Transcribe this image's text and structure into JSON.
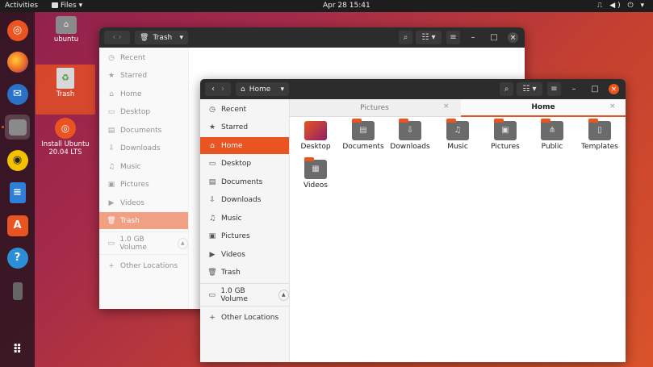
{
  "topbar": {
    "activities": "Activities",
    "app_menu": "Files ▾",
    "clock": "Apr 28  15:41",
    "tray": "⎍ ◀) ⏻ ▾"
  },
  "desktop": {
    "home_label": "ubuntu",
    "trash_label": "Trash",
    "install_label_1": "Install Ubuntu",
    "install_label_2": "20.04 LTS"
  },
  "back_window": {
    "path": "Trash",
    "sidebar": [
      "Recent",
      "Starred",
      "Home",
      "Desktop",
      "Documents",
      "Downloads",
      "Music",
      "Pictures",
      "Videos",
      "Trash"
    ],
    "volume": "1.0 GB Volume",
    "other": "Other Locations"
  },
  "front_window": {
    "path": "Home",
    "sidebar": [
      "Recent",
      "Starred",
      "Home",
      "Desktop",
      "Documents",
      "Downloads",
      "Music",
      "Pictures",
      "Videos",
      "Trash"
    ],
    "volume": "1.0 GB Volume",
    "other": "Other Locations",
    "tabs": [
      "Pictures",
      "Home"
    ],
    "folders": [
      "Desktop",
      "Documents",
      "Downloads",
      "Music",
      "Pictures",
      "Public",
      "Templates",
      "Videos"
    ]
  },
  "colors": {
    "accent": "#e95420",
    "header": "#2c2c2c",
    "dock": "#2a1420"
  }
}
